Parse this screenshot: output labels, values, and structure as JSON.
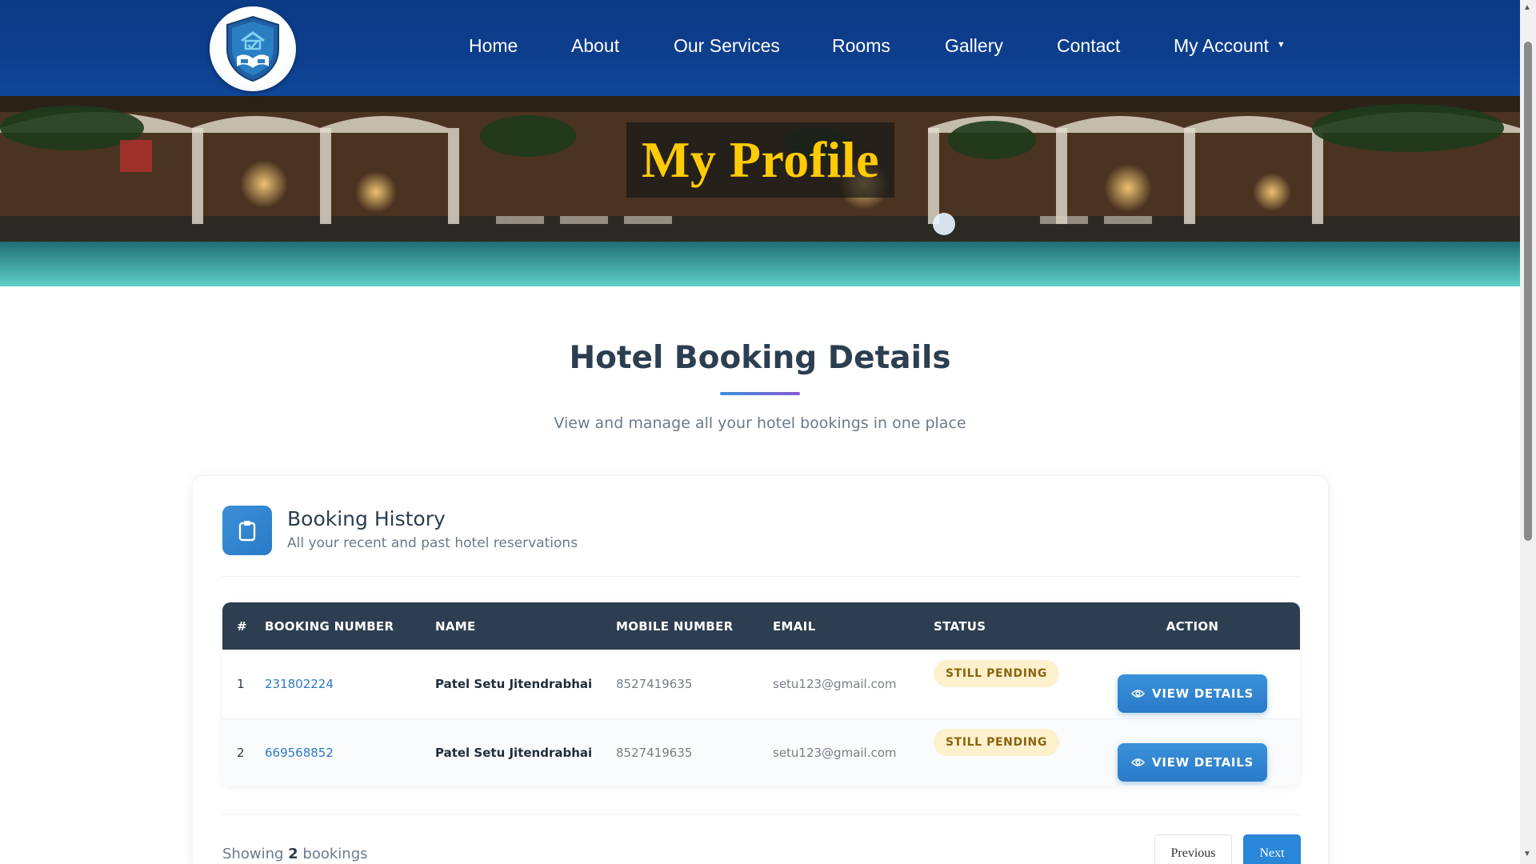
{
  "nav": {
    "logo_icon": "hotel-shield-logo-icon",
    "items": [
      {
        "label": "Home"
      },
      {
        "label": "About"
      },
      {
        "label": "Our Services"
      },
      {
        "label": "Rooms"
      },
      {
        "label": "Gallery"
      },
      {
        "label": "Contact"
      },
      {
        "label": "My Account"
      }
    ],
    "dropdown_icon": "caret-down-icon"
  },
  "hero": {
    "title": "My Profile"
  },
  "section": {
    "title": "Hotel Booking Details",
    "subtitle": "View and manage all your hotel bookings in one place"
  },
  "card": {
    "icon": "clipboard-icon",
    "title": "Booking History",
    "subtitle": "All your recent and past hotel reservations"
  },
  "table": {
    "headers": [
      "#",
      "BOOKING NUMBER",
      "NAME",
      "MOBILE NUMBER",
      "EMAIL",
      "STATUS",
      "ACTION"
    ],
    "rows": [
      {
        "index": "1",
        "booking_number": "231802224",
        "name": "Patel Setu Jitendrabhai",
        "mobile": "8527419635",
        "email": "setu123@gmail.com",
        "status": "STILL PENDING",
        "action": "VIEW DETAILS"
      },
      {
        "index": "2",
        "booking_number": "669568852",
        "name": "Patel Setu Jitendrabhai",
        "mobile": "8527419635",
        "email": "setu123@gmail.com",
        "status": "STILL PENDING",
        "action": "VIEW DETAILS"
      }
    ]
  },
  "footer": {
    "showing_prefix": "Showing",
    "count": "2",
    "showing_suffix": "bookings",
    "prev_label": "Previous",
    "next_label": "Next"
  },
  "colors": {
    "nav_bg": "#0d3e8c",
    "hero_title": "#ffcb05",
    "accent_blue": "#2a7bc8",
    "table_header": "#2d3e50",
    "badge_bg": "#fdf0cd",
    "badge_text": "#8a6410"
  }
}
